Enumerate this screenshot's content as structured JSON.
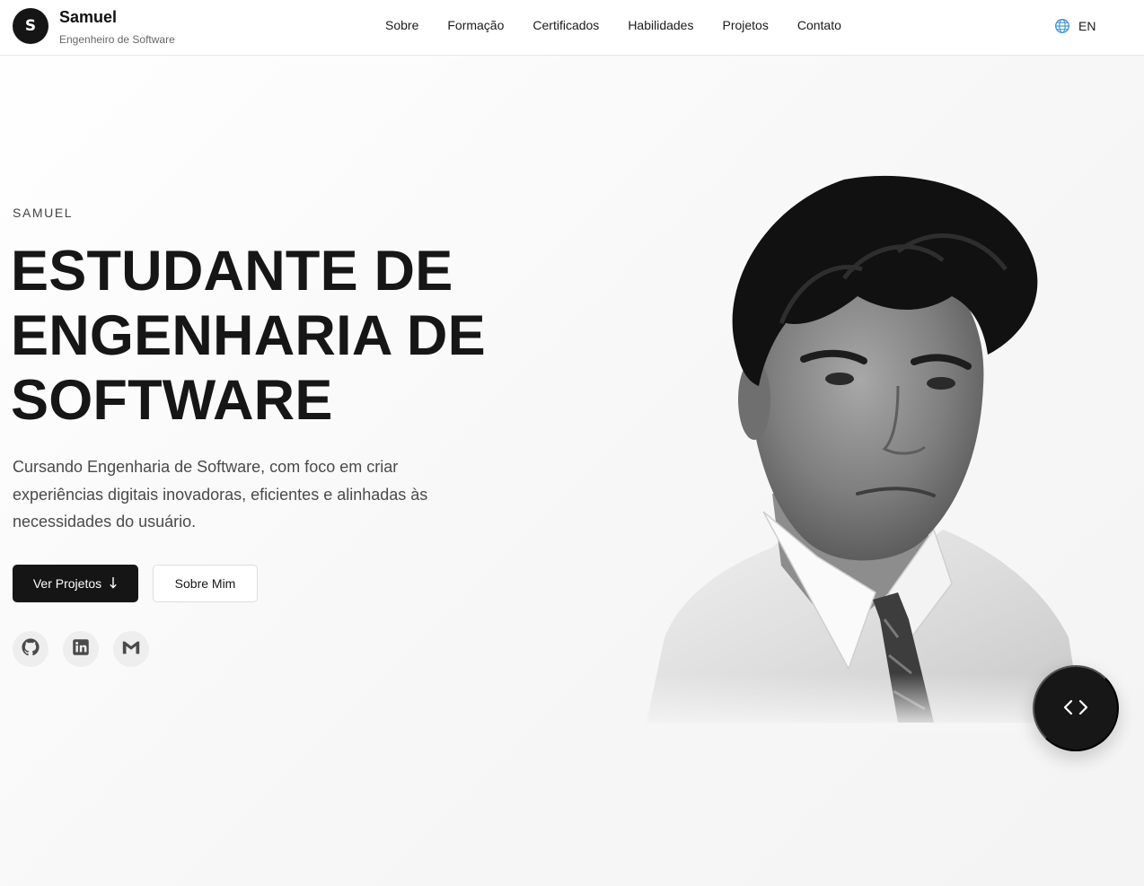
{
  "header": {
    "avatar_letter": "S",
    "name": "Samuel",
    "subtitle": "Engenheiro de Software",
    "nav": [
      "Sobre",
      "Formação",
      "Certificados",
      "Habilidades",
      "Projetos",
      "Contato"
    ],
    "language": {
      "label": "EN",
      "icon": "globe-icon"
    }
  },
  "hero": {
    "eyebrow": "SAMUEL",
    "headline_lines": [
      "ESTUDANTE DE",
      "ENGENHARIA DE",
      "SOFTWARE"
    ],
    "description": "Cursando Engenharia de Software, com foco em criar experiências digitais inovadoras, eficientes e alinhadas às necessidades do usuário.",
    "primary_button": {
      "label": "Ver Projetos",
      "icon": "arrow-down-icon"
    },
    "secondary_button": {
      "label": "Sobre Mim"
    },
    "socials": [
      "github-icon",
      "linkedin-icon",
      "gmail-icon"
    ]
  },
  "portrait": {
    "description": "black-and-white portrait photo"
  },
  "fab": {
    "icon": "code-icon"
  },
  "colors": {
    "dark": "#151515",
    "accent_globe": "#3b8fd6",
    "muted": "#eeeeee"
  }
}
